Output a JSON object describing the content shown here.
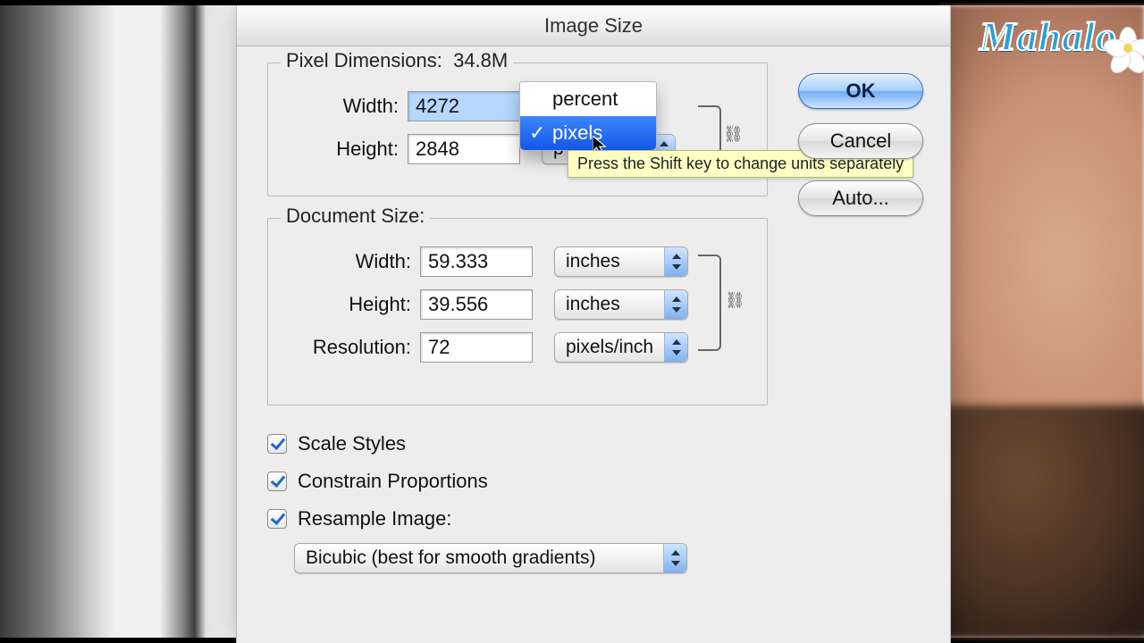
{
  "brand": "Mahalo",
  "dialog": {
    "title": "Image Size",
    "pixel_dimensions": {
      "legend": "Pixel Dimensions:",
      "filesize": "34.8M",
      "width_label": "Width:",
      "width_value": "4272",
      "height_label": "Height:",
      "height_value": "2848",
      "unit_menu": {
        "items": [
          "percent",
          "pixels"
        ],
        "selected": "pixels"
      }
    },
    "document_size": {
      "legend": "Document Size:",
      "width_label": "Width:",
      "width_value": "59.333",
      "width_unit": "inches",
      "height_label": "Height:",
      "height_value": "39.556",
      "height_unit": "inches",
      "resolution_label": "Resolution:",
      "resolution_value": "72",
      "resolution_unit": "pixels/inch"
    },
    "checks": {
      "scale_styles": "Scale Styles",
      "constrain_proportions": "Constrain Proportions",
      "resample_image": "Resample Image:",
      "resample_method": "Bicubic (best for smooth gradients)"
    },
    "buttons": {
      "ok": "OK",
      "cancel": "Cancel",
      "auto": "Auto..."
    },
    "tooltip": "Press the Shift key to change units separately"
  }
}
